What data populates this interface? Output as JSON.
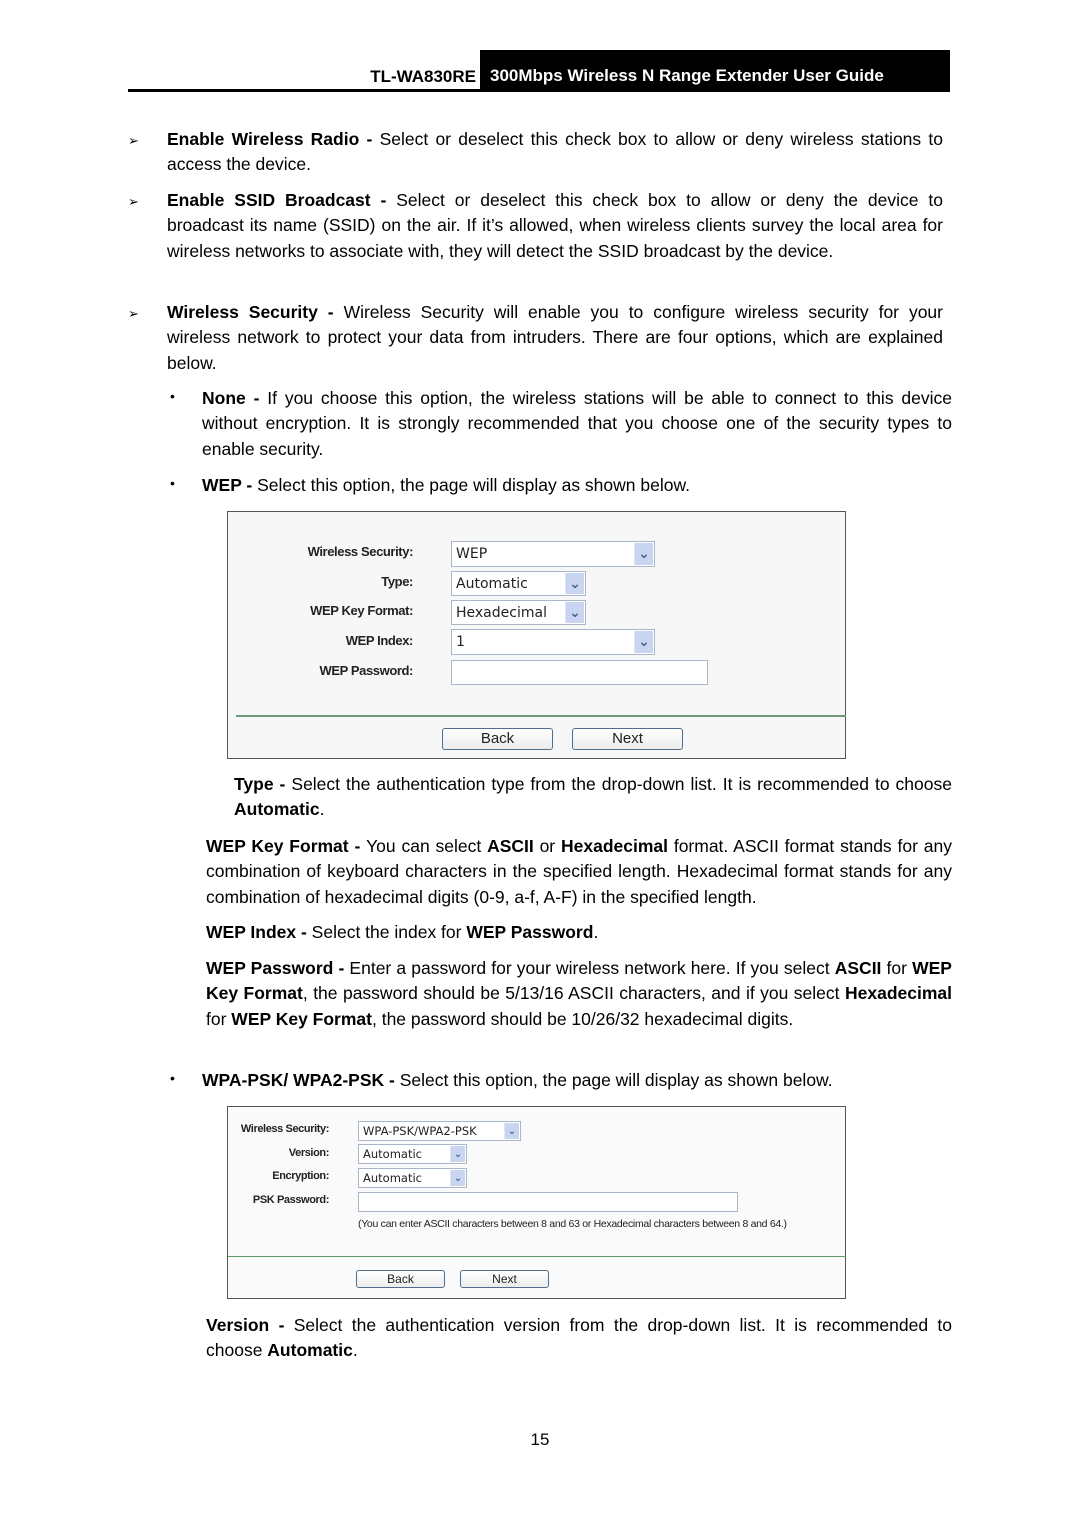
{
  "header": {
    "model": "TL-WA830RE",
    "title": "300Mbps Wireless N Range Extender User Guide"
  },
  "bullets": {
    "arrow": "➢",
    "dot": "•"
  },
  "sections": {
    "enable_radio": {
      "term": "Enable Wireless Radio - ",
      "text": "Select or deselect this check box to allow or deny wireless stations to access the device."
    },
    "enable_ssid": {
      "term": "Enable SSID Broadcast - ",
      "text": "Select or deselect this check box to allow or deny the device to broadcast its name (SSID) on the air. If it’s allowed, when wireless clients survey the local area for wireless networks to associate with, they will detect the SSID broadcast by the device."
    },
    "wireless_security": {
      "term": "Wireless Security - ",
      "text": "Wireless Security will enable you to configure wireless security for your wireless network to protect your data from intruders. There are four options, which are explained below."
    },
    "none": {
      "term": "None - ",
      "text": "If you choose this option, the wireless stations will be able to connect to this device without encryption. It is strongly recommended that you choose one of the security types to enable security."
    },
    "wep": {
      "term": "WEP - ",
      "text": "Select this option, the page will display as shown below."
    },
    "type": {
      "term": "Type - ",
      "text": "Select the authentication type from the drop-down list. It is recommended to choose ",
      "bold_end": "Automatic",
      "end": "."
    },
    "wep_key_format": {
      "term": "WEP Key Format - ",
      "t1": "You can select ",
      "b1": "ASCII",
      "t2": " or ",
      "b2": "Hexadecimal",
      "t3": " format. ASCII format stands for any combination of keyboard characters in the specified length. Hexadecimal format stands for any combination of hexadecimal digits (0-9, a-f, A-F) in the specified length."
    },
    "wep_index": {
      "term": "WEP Index - ",
      "text": "Select the index for ",
      "bold_end": "WEP Password",
      "end": "."
    },
    "wep_password": {
      "term": "WEP Password - ",
      "t1": "Enter a password for your wireless network here. If you select ",
      "b1": "ASCII",
      "t2": " for ",
      "b2": "WEP Key Format",
      "t3": ", the password should be 5/13/16 ASCII characters, and if you select ",
      "b3": "Hexadecimal",
      "t4": " for ",
      "b4": "WEP Key Format",
      "t5": ", the password should be 10/26/32 hexadecimal digits."
    },
    "wpa": {
      "term": "WPA-PSK/ WPA2-PSK - ",
      "text": "Select this option, the page will display as shown below."
    },
    "version": {
      "term": "Version - ",
      "text": "Select the authentication version from the drop-down list. It is recommended to choose ",
      "bold_end": "Automatic",
      "end": "."
    }
  },
  "wep_panel": {
    "wireless_security_label": "Wireless Security:",
    "wireless_security_value": "WEP",
    "type_label": "Type:",
    "type_value": "Automatic",
    "key_format_label": "WEP Key Format:",
    "key_format_value": "Hexadecimal",
    "index_label": "WEP Index:",
    "index_value": "1",
    "password_label": "WEP Password:",
    "password_value": "",
    "back_label": "Back",
    "next_label": "Next",
    "arrow_glyph": "⌄"
  },
  "wpa_panel": {
    "wireless_security_label": "Wireless Security:",
    "wireless_security_value": "WPA-PSK/WPA2-PSK",
    "version_label": "Version:",
    "version_value": "Automatic",
    "encryption_label": "Encryption:",
    "encryption_value": "Automatic",
    "psk_password_label": "PSK Password:",
    "psk_password_value": "",
    "hint": "(You can enter ASCII characters between 8 and 63 or Hexadecimal characters between 8 and 64.)",
    "back_label": "Back",
    "next_label": "Next",
    "arrow_glyph": "⌄"
  },
  "footer": {
    "page_number": "15"
  }
}
